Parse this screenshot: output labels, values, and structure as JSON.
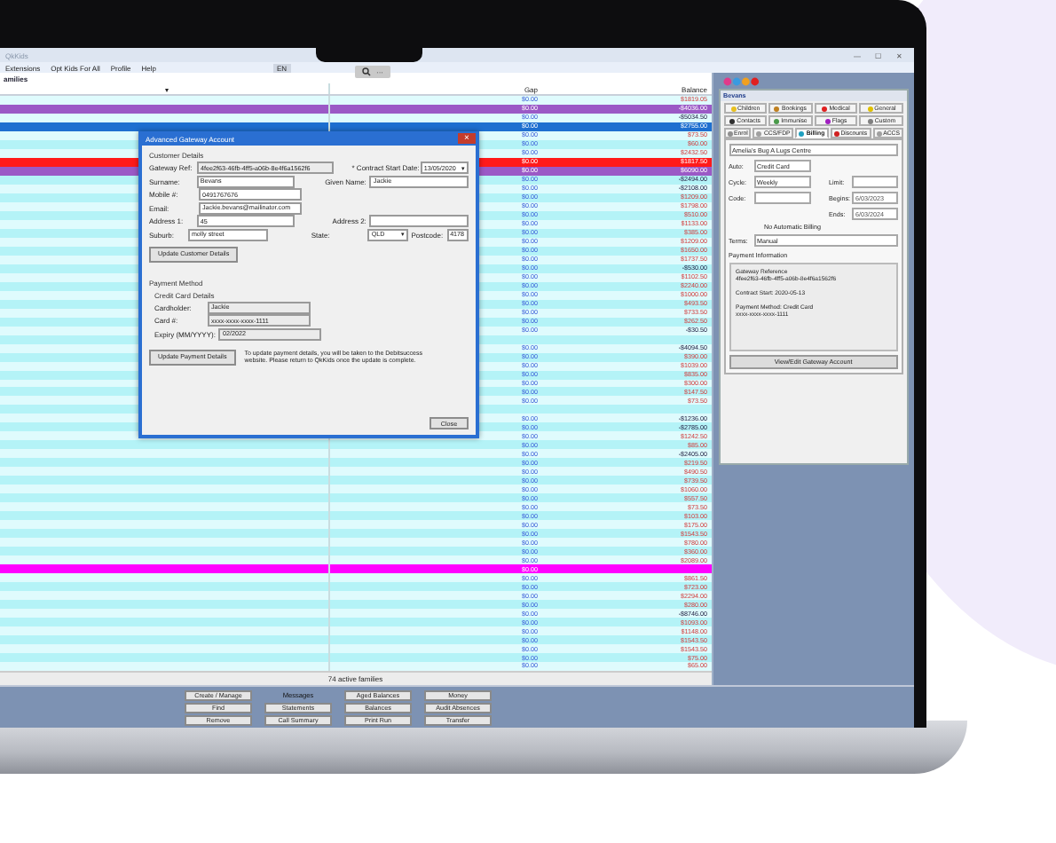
{
  "window": {
    "title": "QkKids",
    "search_more": "···",
    "controls": [
      "—",
      "☐",
      "✕"
    ]
  },
  "menu": {
    "items": [
      "Extensions",
      "Opt Kids For All",
      "Profile",
      "Help"
    ],
    "language": "EN"
  },
  "families": {
    "title": "amilies",
    "name_column_caret": "▾",
    "columns": [
      "Gap",
      "Balance"
    ],
    "rows": [
      {
        "gap": "$0.00",
        "balance": "$1819.05",
        "credit": false
      },
      {
        "gap": "$0.00",
        "balance": "-$4036.00",
        "credit": true,
        "color": "#9b59c6"
      },
      {
        "gap": "$0.00",
        "balance": "-$5034.50",
        "credit": true
      },
      {
        "gap": "$0.00",
        "balance": "$2755.00",
        "credit": false,
        "color": "#1e6fd0"
      },
      {
        "gap": "$0.00",
        "balance": "$73.50",
        "credit": false
      },
      {
        "gap": "$0.00",
        "balance": "$60.00",
        "credit": false
      },
      {
        "gap": "$0.00",
        "balance": "$2432.50",
        "credit": false
      },
      {
        "gap": "$0.00",
        "balance": "$1817.50",
        "credit": false,
        "color": "#ff1a1a"
      },
      {
        "gap": "$0.00",
        "balance": "$6090.00",
        "credit": false,
        "color": "#9b59c6"
      },
      {
        "gap": "$0.00",
        "balance": "-$2494.00",
        "credit": true
      },
      {
        "gap": "$0.00",
        "balance": "-$2108.00",
        "credit": true
      },
      {
        "gap": "$0.00",
        "balance": "$1209.00",
        "credit": false
      },
      {
        "gap": "$0.00",
        "balance": "$1798.00",
        "credit": false
      },
      {
        "gap": "$0.00",
        "balance": "$510.00",
        "credit": false
      },
      {
        "gap": "$0.00",
        "balance": "$1133.00",
        "credit": false
      },
      {
        "gap": "$0.00",
        "balance": "$385.00",
        "credit": false
      },
      {
        "gap": "$0.00",
        "balance": "$1209.00",
        "credit": false
      },
      {
        "gap": "$0.00",
        "balance": "$1650.00",
        "credit": false
      },
      {
        "gap": "$0.00",
        "balance": "$1737.50",
        "credit": false
      },
      {
        "gap": "$0.00",
        "balance": "-$530.00",
        "credit": true
      },
      {
        "gap": "$0.00",
        "balance": "$1102.50",
        "credit": false
      },
      {
        "gap": "$0.00",
        "balance": "$2240.00",
        "credit": false
      },
      {
        "gap": "$0.00",
        "balance": "$1000.00",
        "credit": false
      },
      {
        "gap": "$0.00",
        "balance": "$493.50",
        "credit": false
      },
      {
        "gap": "$0.00",
        "balance": "$733.50",
        "credit": false
      },
      {
        "gap": "$0.00",
        "balance": "$262.50",
        "credit": false
      },
      {
        "gap": "$0.00",
        "balance": "-$30.50",
        "credit": true
      },
      {},
      {
        "gap": "$0.00",
        "balance": "-$4094.50",
        "credit": true
      },
      {
        "gap": "$0.00",
        "balance": "$390.00",
        "credit": false
      },
      {
        "gap": "$0.00",
        "balance": "$1039.00",
        "credit": false
      },
      {
        "gap": "$0.00",
        "balance": "$835.00",
        "credit": false
      },
      {
        "gap": "$0.00",
        "balance": "$300.00",
        "credit": false
      },
      {
        "gap": "$0.00",
        "balance": "$147.50",
        "credit": false
      },
      {
        "gap": "$0.00",
        "balance": "$73.50",
        "credit": false
      },
      {},
      {
        "gap": "$0.00",
        "balance": "-$1236.00",
        "credit": true
      },
      {
        "gap": "$0.00",
        "balance": "-$2785.00",
        "credit": true
      },
      {
        "gap": "$0.00",
        "balance": "$1242.50",
        "credit": false
      },
      {
        "gap": "$0.00",
        "balance": "$85.00",
        "credit": false
      },
      {
        "gap": "$0.00",
        "balance": "-$2405.00",
        "credit": true
      },
      {
        "gap": "$0.00",
        "balance": "$219.50",
        "credit": false
      },
      {
        "gap": "$0.00",
        "balance": "$490.50",
        "credit": false
      },
      {
        "gap": "$0.00",
        "balance": "$739.50",
        "credit": false
      },
      {
        "gap": "$0.00",
        "balance": "$1060.00",
        "credit": false
      },
      {
        "gap": "$0.00",
        "balance": "$557.50",
        "credit": false
      },
      {
        "gap": "$0.00",
        "balance": "$73.50",
        "credit": false
      },
      {
        "gap": "$0.00",
        "balance": "$103.00",
        "credit": false
      },
      {
        "gap": "$0.00",
        "balance": "$175.00",
        "credit": false
      },
      {
        "gap": "$0.00",
        "balance": "$1543.50",
        "credit": false
      },
      {
        "gap": "$0.00",
        "balance": "$780.00",
        "credit": false
      },
      {
        "gap": "$0.00",
        "balance": "$360.00",
        "credit": false
      },
      {
        "gap": "$0.00",
        "balance": "$2089.00",
        "credit": false
      },
      {
        "gap": "$0.00",
        "color": "#ff00ff"
      },
      {
        "gap": "$0.00",
        "balance": "$861.50",
        "credit": false
      },
      {
        "gap": "$0.00",
        "balance": "$723.00",
        "credit": false
      },
      {
        "gap": "$0.00",
        "balance": "$2294.00",
        "credit": false
      },
      {
        "gap": "$0.00",
        "balance": "$280.00",
        "credit": false
      },
      {
        "gap": "$0.00",
        "balance": "-$8746.00",
        "credit": true
      },
      {
        "gap": "$0.00",
        "balance": "$1093.00",
        "credit": false
      },
      {
        "gap": "$0.00",
        "balance": "$1148.00",
        "credit": false
      },
      {
        "gap": "$0.00",
        "balance": "$1543.50",
        "credit": false
      },
      {
        "gap": "$0.00",
        "balance": "$1543.50",
        "credit": false
      },
      {
        "gap": "$0.00",
        "balance": "$75.00",
        "credit": false
      },
      {
        "gap": "$0.00",
        "balance": "$65.00",
        "credit": false
      }
    ],
    "footer": "74 active families"
  },
  "actions": [
    {
      "kind": "button",
      "label": "Create / Manage"
    },
    {
      "kind": "label",
      "label": "Messages"
    },
    {
      "kind": "button",
      "label": "Aged Balances"
    },
    {
      "kind": "button",
      "label": "Money"
    },
    {
      "kind": "button",
      "label": "Find"
    },
    {
      "kind": "button",
      "label": "Statements"
    },
    {
      "kind": "button",
      "label": "Balances"
    },
    {
      "kind": "button",
      "label": "Audit Absences"
    },
    {
      "kind": "button",
      "label": "Remove"
    },
    {
      "kind": "button",
      "label": "Call Summary"
    },
    {
      "kind": "button",
      "label": "Print Run"
    },
    {
      "kind": "button",
      "label": "Transfer"
    }
  ],
  "dialog": {
    "title": "Advanced Gateway Account",
    "close": "×",
    "customer_section": "Customer Details",
    "gateway_ref": {
      "label": "Gateway Ref:",
      "value": "4fee2f63-46fb-4ff5-a06b-8e4f6a1562f6"
    },
    "contract_start": {
      "label": "* Contract Start Date:",
      "value": "13/05/2020",
      "caret": "▾"
    },
    "surname": {
      "label": "Surname:",
      "value": "Bevans"
    },
    "given_name": {
      "label": "Given Name:",
      "value": "Jackie"
    },
    "mobile": {
      "label": "Mobile #:",
      "value": "0491767676"
    },
    "email": {
      "label": "Email:",
      "value": "Jackie.bevans@mailinator.com"
    },
    "address1": {
      "label": "Address 1:",
      "value": "45"
    },
    "address2": {
      "label": "Address 2:"
    },
    "suburb": {
      "label": "Suburb:",
      "value": "molly street"
    },
    "state": {
      "label": "State:",
      "value": "QLD",
      "caret": "▾"
    },
    "postcode": {
      "label": "Postcode:",
      "value": "4178"
    },
    "update_customer": "Update Customer Details",
    "payment_section": "Payment Method",
    "card_section": "Credit Card Details",
    "cardholder": {
      "label": "Cardholder:",
      "value": "Jackie"
    },
    "card": {
      "label": "Card #:",
      "value": "xxxx-xxxx-xxxx-1111"
    },
    "expiry": {
      "label": "Expiry (MM/YYYY):",
      "value": "02/2022"
    },
    "update_payment": "Update Payment Details",
    "note": "To update payment details, you will be taken to the Debitsuccess website. Please return to QkKids once the update is complete.",
    "close_button": "Close"
  },
  "family_panel": {
    "title": "Bevans",
    "tabs": [
      [
        {
          "label": "Children",
          "selected": false
        },
        {
          "label": "Bookings",
          "selected": false
        },
        {
          "label": "Medical",
          "selected": false
        },
        {
          "label": "General",
          "selected": false
        }
      ],
      [
        {
          "label": "Contacts",
          "selected": false
        },
        {
          "label": "Immunise",
          "selected": false
        },
        {
          "label": "Flags",
          "selected": false
        },
        {
          "label": "Custom",
          "selected": false
        }
      ],
      [
        {
          "label": "Enrol",
          "selected": false
        },
        {
          "label": "CCS/FDP",
          "selected": false
        },
        {
          "label": "Billing",
          "selected": true
        },
        {
          "label": "Discounts",
          "selected": false
        },
        {
          "label": "ACCS",
          "selected": false
        }
      ]
    ],
    "centre": "Amelia's Bug A Lugs Centre",
    "auto": {
      "label": "Auto:",
      "value": "Credit Card"
    },
    "cycle": {
      "label": "Cycle:",
      "value": "Weekly"
    },
    "limit": {
      "label": "Limit:"
    },
    "code": {
      "label": "Code:"
    },
    "begins": {
      "label": "Begins:",
      "value": "6/03/2023"
    },
    "ends": {
      "label": "Ends:",
      "value": "6/03/2024"
    },
    "no_auto": "No Automatic Billing",
    "terms": {
      "label": "Terms:",
      "value": "Manual"
    },
    "payment_info": {
      "title": "Payment Information",
      "paragraphs": [
        [
          "Gateway Reference",
          "4fee2f63-46fb-4ff5-a06b-8e4f6a1562f6"
        ],
        [
          "Contract Start: 2020-05-13"
        ],
        [
          "Payment Method: Credit Card",
          "xxxx-xxxx-xxxx-1111"
        ]
      ]
    },
    "gateway_button": "View/Edit Gateway Account"
  }
}
